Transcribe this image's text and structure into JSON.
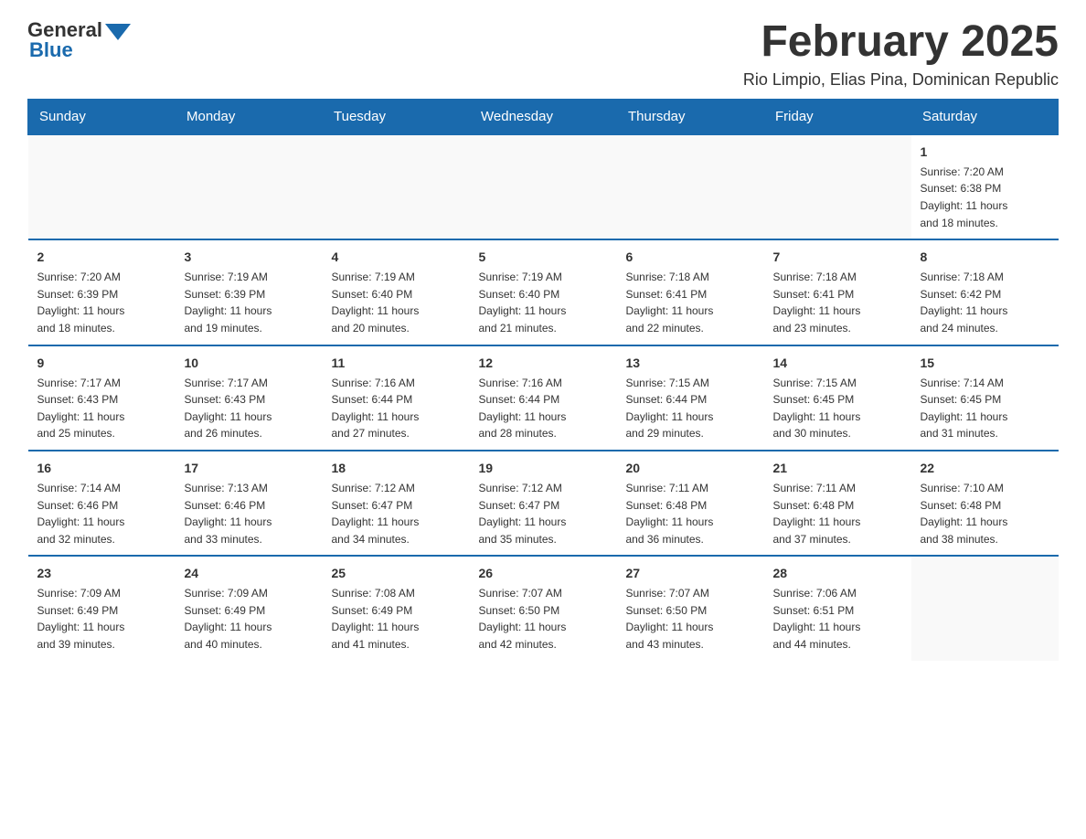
{
  "header": {
    "logo_general": "General",
    "logo_blue": "Blue",
    "title": "February 2025",
    "subtitle": "Rio Limpio, Elias Pina, Dominican Republic"
  },
  "days_of_week": [
    "Sunday",
    "Monday",
    "Tuesday",
    "Wednesday",
    "Thursday",
    "Friday",
    "Saturday"
  ],
  "weeks": [
    [
      {
        "day": "",
        "info": ""
      },
      {
        "day": "",
        "info": ""
      },
      {
        "day": "",
        "info": ""
      },
      {
        "day": "",
        "info": ""
      },
      {
        "day": "",
        "info": ""
      },
      {
        "day": "",
        "info": ""
      },
      {
        "day": "1",
        "info": "Sunrise: 7:20 AM\nSunset: 6:38 PM\nDaylight: 11 hours\nand 18 minutes."
      }
    ],
    [
      {
        "day": "2",
        "info": "Sunrise: 7:20 AM\nSunset: 6:39 PM\nDaylight: 11 hours\nand 18 minutes."
      },
      {
        "day": "3",
        "info": "Sunrise: 7:19 AM\nSunset: 6:39 PM\nDaylight: 11 hours\nand 19 minutes."
      },
      {
        "day": "4",
        "info": "Sunrise: 7:19 AM\nSunset: 6:40 PM\nDaylight: 11 hours\nand 20 minutes."
      },
      {
        "day": "5",
        "info": "Sunrise: 7:19 AM\nSunset: 6:40 PM\nDaylight: 11 hours\nand 21 minutes."
      },
      {
        "day": "6",
        "info": "Sunrise: 7:18 AM\nSunset: 6:41 PM\nDaylight: 11 hours\nand 22 minutes."
      },
      {
        "day": "7",
        "info": "Sunrise: 7:18 AM\nSunset: 6:41 PM\nDaylight: 11 hours\nand 23 minutes."
      },
      {
        "day": "8",
        "info": "Sunrise: 7:18 AM\nSunset: 6:42 PM\nDaylight: 11 hours\nand 24 minutes."
      }
    ],
    [
      {
        "day": "9",
        "info": "Sunrise: 7:17 AM\nSunset: 6:43 PM\nDaylight: 11 hours\nand 25 minutes."
      },
      {
        "day": "10",
        "info": "Sunrise: 7:17 AM\nSunset: 6:43 PM\nDaylight: 11 hours\nand 26 minutes."
      },
      {
        "day": "11",
        "info": "Sunrise: 7:16 AM\nSunset: 6:44 PM\nDaylight: 11 hours\nand 27 minutes."
      },
      {
        "day": "12",
        "info": "Sunrise: 7:16 AM\nSunset: 6:44 PM\nDaylight: 11 hours\nand 28 minutes."
      },
      {
        "day": "13",
        "info": "Sunrise: 7:15 AM\nSunset: 6:44 PM\nDaylight: 11 hours\nand 29 minutes."
      },
      {
        "day": "14",
        "info": "Sunrise: 7:15 AM\nSunset: 6:45 PM\nDaylight: 11 hours\nand 30 minutes."
      },
      {
        "day": "15",
        "info": "Sunrise: 7:14 AM\nSunset: 6:45 PM\nDaylight: 11 hours\nand 31 minutes."
      }
    ],
    [
      {
        "day": "16",
        "info": "Sunrise: 7:14 AM\nSunset: 6:46 PM\nDaylight: 11 hours\nand 32 minutes."
      },
      {
        "day": "17",
        "info": "Sunrise: 7:13 AM\nSunset: 6:46 PM\nDaylight: 11 hours\nand 33 minutes."
      },
      {
        "day": "18",
        "info": "Sunrise: 7:12 AM\nSunset: 6:47 PM\nDaylight: 11 hours\nand 34 minutes."
      },
      {
        "day": "19",
        "info": "Sunrise: 7:12 AM\nSunset: 6:47 PM\nDaylight: 11 hours\nand 35 minutes."
      },
      {
        "day": "20",
        "info": "Sunrise: 7:11 AM\nSunset: 6:48 PM\nDaylight: 11 hours\nand 36 minutes."
      },
      {
        "day": "21",
        "info": "Sunrise: 7:11 AM\nSunset: 6:48 PM\nDaylight: 11 hours\nand 37 minutes."
      },
      {
        "day": "22",
        "info": "Sunrise: 7:10 AM\nSunset: 6:48 PM\nDaylight: 11 hours\nand 38 minutes."
      }
    ],
    [
      {
        "day": "23",
        "info": "Sunrise: 7:09 AM\nSunset: 6:49 PM\nDaylight: 11 hours\nand 39 minutes."
      },
      {
        "day": "24",
        "info": "Sunrise: 7:09 AM\nSunset: 6:49 PM\nDaylight: 11 hours\nand 40 minutes."
      },
      {
        "day": "25",
        "info": "Sunrise: 7:08 AM\nSunset: 6:49 PM\nDaylight: 11 hours\nand 41 minutes."
      },
      {
        "day": "26",
        "info": "Sunrise: 7:07 AM\nSunset: 6:50 PM\nDaylight: 11 hours\nand 42 minutes."
      },
      {
        "day": "27",
        "info": "Sunrise: 7:07 AM\nSunset: 6:50 PM\nDaylight: 11 hours\nand 43 minutes."
      },
      {
        "day": "28",
        "info": "Sunrise: 7:06 AM\nSunset: 6:51 PM\nDaylight: 11 hours\nand 44 minutes."
      },
      {
        "day": "",
        "info": ""
      }
    ]
  ]
}
